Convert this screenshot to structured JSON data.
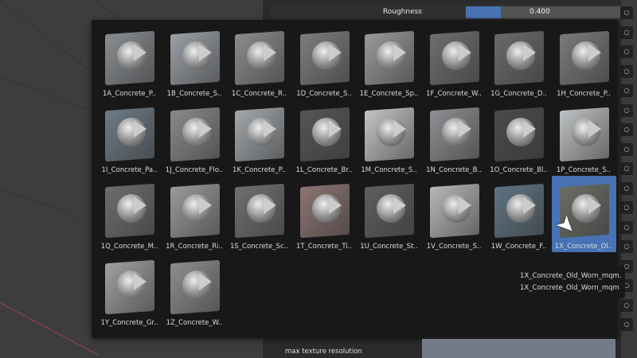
{
  "property": {
    "label": "Roughness",
    "value": "0.400",
    "fraction": 0.4
  },
  "accent": "#4772b3",
  "materials": [
    {
      "label": "1A_Concrete_P..",
      "tone": "#8a8e92"
    },
    {
      "label": "1B_Concrete_S..",
      "tone": "#9aa0a6"
    },
    {
      "label": "1C_Concrete_R..",
      "tone": "#8c8c8c"
    },
    {
      "label": "1D_Concrete_S..",
      "tone": "#7d7d7d"
    },
    {
      "label": "1E_Concrete_Sp..",
      "tone": "#999999"
    },
    {
      "label": "1F_Concrete_W..",
      "tone": "#6e6e6e"
    },
    {
      "label": "1G_Concrete_D..",
      "tone": "#6a6a6a"
    },
    {
      "label": "1H_Concrete_P..",
      "tone": "#7a7a7a"
    },
    {
      "label": "1I_Concrete_Pa..",
      "tone": "#6d7b86"
    },
    {
      "label": "1J_Concrete_Flo..",
      "tone": "#8a8a8a"
    },
    {
      "label": "1K_Concrete_P..",
      "tone": "#a3a8ac"
    },
    {
      "label": "1L_Concrete_Br..",
      "tone": "#555555"
    },
    {
      "label": "1M_Concrete_S..",
      "tone": "#c4c4c4"
    },
    {
      "label": "1N_Concrete_B..",
      "tone": "#8d8f92"
    },
    {
      "label": "1O_Concrete_Bl..",
      "tone": "#4a4a4a"
    },
    {
      "label": "1P_Concrete_S..",
      "tone": "#bfc2c4"
    },
    {
      "label": "1Q_Concrete_M..",
      "tone": "#6b6e70"
    },
    {
      "label": "1R_Concrete_Ri..",
      "tone": "#9a9a9a"
    },
    {
      "label": "1S_Concrete_Sc..",
      "tone": "#707070"
    },
    {
      "label": "1T_Concrete_Ti..",
      "tone": "#8c7572"
    },
    {
      "label": "1U_Concrete_St..",
      "tone": "#5e5e5e"
    },
    {
      "label": "1V_Concrete_S..",
      "tone": "#b8b8b8"
    },
    {
      "label": "1W_Concrete_F..",
      "tone": "#5f7382"
    },
    {
      "label": "1X_Concrete_Ol..",
      "tone": "#6b6e68",
      "selected": true
    },
    {
      "label": "1Y_Concrete_Gr..",
      "tone": "#9ea0a2"
    },
    {
      "label": "1Z_Concrete_W..",
      "tone": "#8e8e8e"
    }
  ],
  "tooltip": {
    "line1": "1X_Concrete_Old_Worn_mqm.",
    "line2": "1X_Concrete_Old_Worn_mqm"
  },
  "lower": {
    "field": "max texture resolution"
  }
}
